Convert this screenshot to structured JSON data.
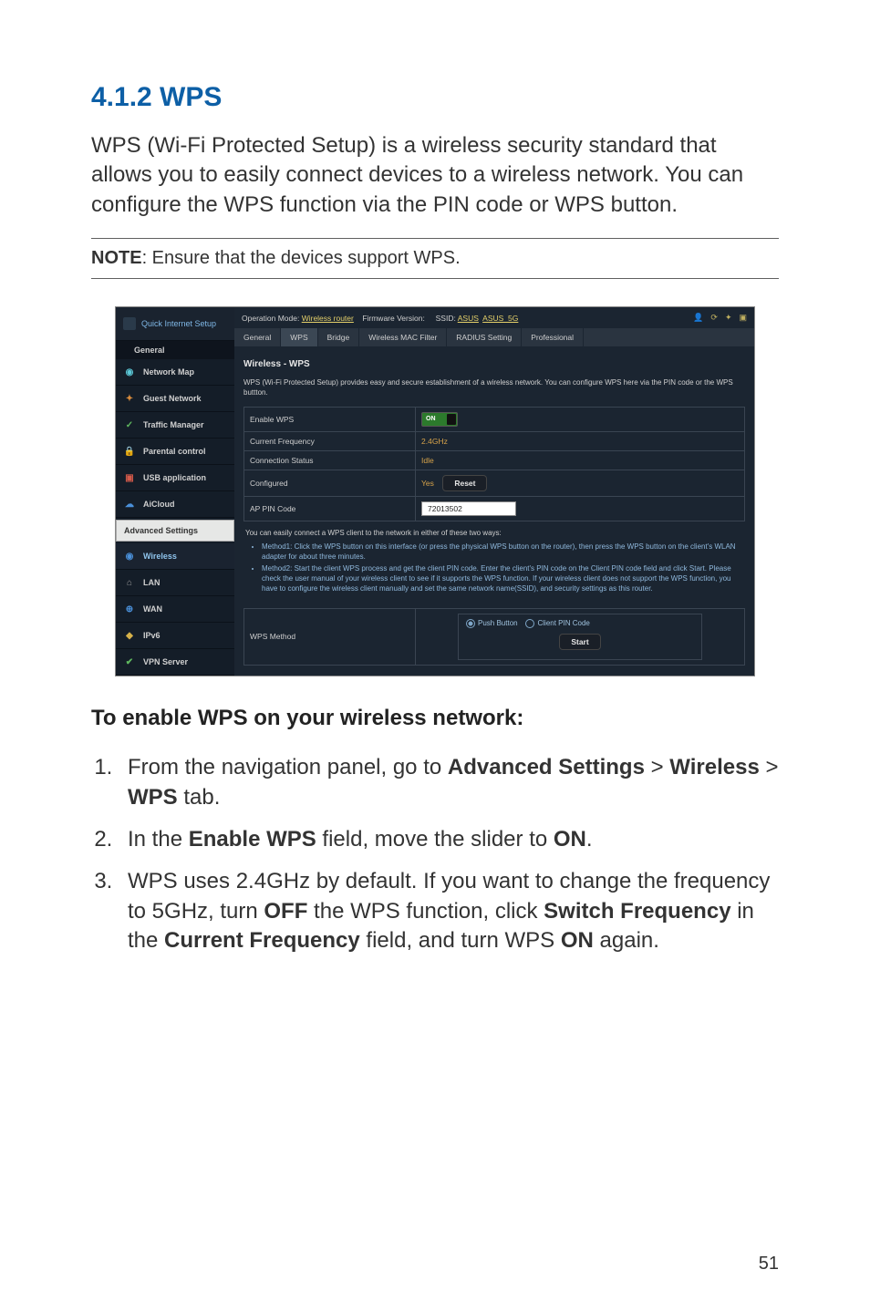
{
  "heading": "4.1.2 WPS",
  "introText": "WPS (Wi-Fi Protected Setup) is a wireless security standard that allows you to easily connect devices to a wireless network. You can configure the WPS function via the PIN code or WPS button.",
  "noteLabel": "NOTE",
  "noteText": ":  Ensure that the devices support WPS.",
  "screenshot": {
    "sidebar": {
      "quickInternetSetup": "Quick Internet Setup",
      "generalHeader": "General",
      "generalItems": [
        {
          "icon": "network-icon",
          "label": "Network Map"
        },
        {
          "icon": "guest-icon",
          "label": "Guest Network"
        },
        {
          "icon": "traffic-icon",
          "label": "Traffic Manager"
        },
        {
          "icon": "parental-icon",
          "label": "Parental control"
        },
        {
          "icon": "usb-icon",
          "label": "USB application"
        },
        {
          "icon": "aicloud-icon",
          "label": "AiCloud"
        }
      ],
      "advancedHeader": "Advanced Settings",
      "advancedItems": [
        {
          "icon": "wireless-icon",
          "label": "Wireless",
          "active": true
        },
        {
          "icon": "lan-icon",
          "label": "LAN"
        },
        {
          "icon": "wan-icon",
          "label": "WAN"
        },
        {
          "icon": "ipv6-icon",
          "label": "IPv6"
        },
        {
          "icon": "vpn-icon",
          "label": "VPN Server"
        }
      ]
    },
    "topbar": {
      "opModeLabel": "Operation Mode:",
      "opModeValue": "Wireless router",
      "fwLabel": "Firmware Version:",
      "ssidLabel": "SSID:",
      "ssid1": "ASUS",
      "ssid2": "ASUS_5G"
    },
    "tabs": [
      "General",
      "WPS",
      "Bridge",
      "Wireless MAC Filter",
      "RADIUS Setting",
      "Professional"
    ],
    "activeTab": "WPS",
    "panelTitle": "Wireless - WPS",
    "panelDesc": "WPS (Wi-Fi Protected Setup) provides easy and secure establishment of a wireless network. You can configure WPS here via the PIN code or the WPS buttton.",
    "rows": {
      "enableWPS": {
        "label": "Enable WPS",
        "value": "ON"
      },
      "currentFrequency": {
        "label": "Current Frequency",
        "value": "2.4GHz"
      },
      "connectionStatus": {
        "label": "Connection Status",
        "value": "Idle"
      },
      "configured": {
        "label": "Configured",
        "value": "Yes",
        "button": "Reset"
      },
      "apPinCode": {
        "label": "AP PIN Code",
        "value": "72013502"
      }
    },
    "methods": {
      "heading": "You can easily connect a WPS client to the network in either of these two ways:",
      "item1": "Method1: Click the WPS button on this interface (or press the physical WPS button on the router), then press the WPS button on the client's WLAN adapter for about three minutes.",
      "item2": "Method2: Start the client WPS process and get the client PIN code. Enter the client's PIN code on the Client PIN code field and click Start. Please check the user manual of your wireless client to see if it supports the WPS function. If your wireless client does not support the WPS function, you have to configure the wireless client manually and set the same network name(SSID), and security settings as this router."
    },
    "wpsMethod": {
      "label": "WPS Method",
      "option1": "Push Button",
      "option2": "Client PIN Code",
      "button": "Start"
    }
  },
  "enableTitle": "To enable WPS on your wireless network:",
  "steps": {
    "s1a": "From the navigation panel, go to ",
    "s1b": "Advanced Settings",
    "s1c": " > ",
    "s1d": "Wireless",
    "s1e": " > ",
    "s1f": "WPS",
    "s1g": " tab.",
    "s2a": "In the ",
    "s2b": "Enable WPS",
    "s2c": " field, move the slider to ",
    "s2d": "ON",
    "s2e": ".",
    "s3a": "WPS uses 2.4GHz by default. If you want to change the frequency to 5GHz, turn ",
    "s3b": "OFF",
    "s3c": " the WPS function, click ",
    "s3d": "Switch Frequency",
    "s3e": " in the ",
    "s3f": "Current Frequency",
    "s3g": " field, and turn WPS ",
    "s3h": "ON",
    "s3i": " again."
  },
  "pageNumber": "51"
}
